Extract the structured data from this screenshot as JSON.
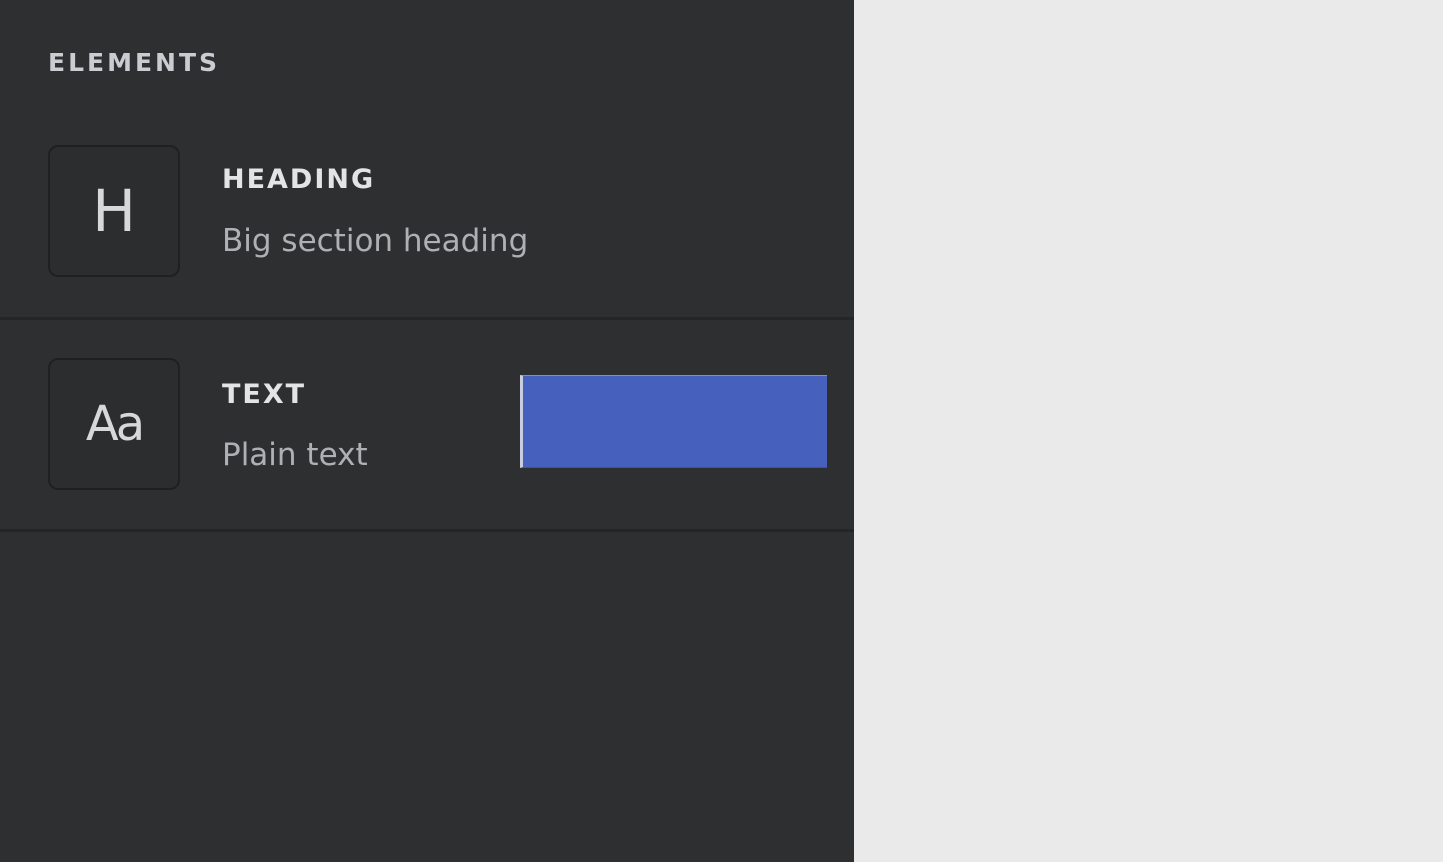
{
  "panel": {
    "section_title": "ELEMENTS",
    "items": [
      {
        "icon": "heading-icon",
        "icon_glyph": "H",
        "label": "HEADING",
        "description": "Big section heading"
      },
      {
        "icon": "text-icon",
        "icon_glyph": "Aa",
        "label": "TEXT",
        "description": "Plain text"
      }
    ]
  },
  "colors": {
    "panel_background": "#2e2f31",
    "canvas_background": "#eaeaea",
    "drop_indicator": "#4560bd",
    "label_text": "#e3e4e6",
    "description_text": "#aeb0b4"
  }
}
